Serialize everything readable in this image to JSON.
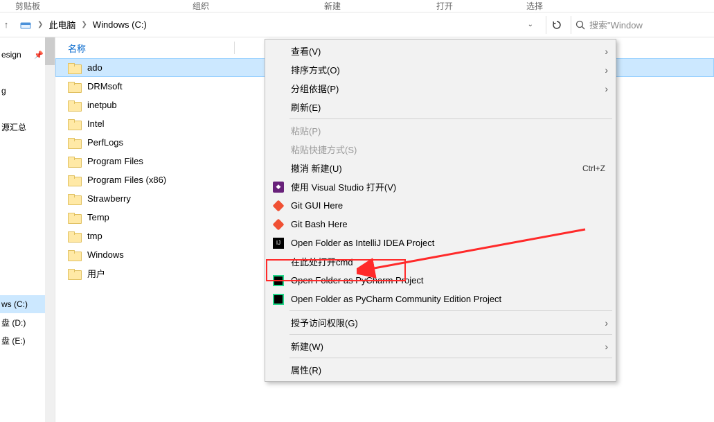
{
  "ribbon": {
    "clipboard": "剪贴板",
    "organize": "组织",
    "new": "新建",
    "open": "打开",
    "select": "选择"
  },
  "breadcrumb": {
    "up_label": "↑",
    "root": "此电脑",
    "loc": "Windows (C:)"
  },
  "search": {
    "placeholder": "搜索\"Window"
  },
  "sidebar": {
    "items": [
      {
        "label": "esign"
      },
      {
        "label": "g"
      },
      {
        "label": "源汇总"
      },
      {
        "label": "ws (C:)",
        "selected": true
      },
      {
        "label": "盘 (D:)"
      },
      {
        "label": "盘 (E:)"
      }
    ]
  },
  "columns": {
    "name": "名称"
  },
  "files": [
    {
      "name": "ado",
      "selected": true
    },
    {
      "name": "DRMsoft"
    },
    {
      "name": "inetpub"
    },
    {
      "name": "Intel"
    },
    {
      "name": "PerfLogs"
    },
    {
      "name": "Program Files"
    },
    {
      "name": "Program Files (x86)"
    },
    {
      "name": "Strawberry"
    },
    {
      "name": "Temp"
    },
    {
      "name": "tmp"
    },
    {
      "name": "Windows"
    },
    {
      "name": "用户"
    }
  ],
  "ctx": {
    "view": "查看(V)",
    "sort": "排序方式(O)",
    "group": "分组依据(P)",
    "refresh": "刷新(E)",
    "paste": "粘贴(P)",
    "paste_shortcut": "粘贴快捷方式(S)",
    "undo_new": "撤消 新建(U)",
    "undo_key": "Ctrl+Z",
    "open_vs": "使用 Visual Studio 打开(V)",
    "git_gui": "Git GUI Here",
    "git_bash": "Git Bash Here",
    "open_ij": "Open Folder as IntelliJ IDEA Project",
    "open_cmd": "在此处打开cmd",
    "open_pc": "Open Folder as PyCharm Project",
    "open_pcc": "Open Folder as PyCharm Community Edition Project",
    "grant": "授予访问权限(G)",
    "new": "新建(W)",
    "props": "属性(R)"
  }
}
